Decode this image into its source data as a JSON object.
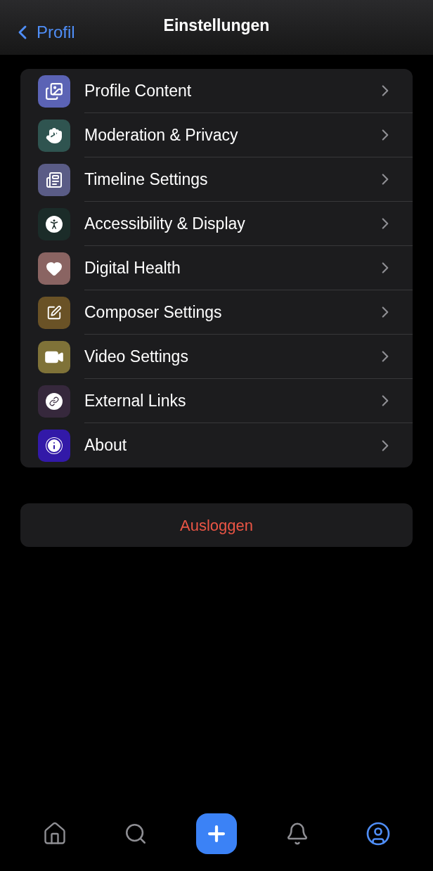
{
  "nav": {
    "back": "Profil",
    "title": "Einstellungen"
  },
  "settings": [
    {
      "label": "Profile Content",
      "color": "#5b63b5"
    },
    {
      "label": "Moderation & Privacy",
      "color": "#2f5450"
    },
    {
      "label": "Timeline Settings",
      "color": "#5a5c86"
    },
    {
      "label": "Accessibility & Display",
      "color": "#1b2c29"
    },
    {
      "label": "Digital Health",
      "color": "#8a6462"
    },
    {
      "label": "Composer Settings",
      "color": "#6a5226"
    },
    {
      "label": "Video Settings",
      "color": "#7f7238"
    },
    {
      "label": "External Links",
      "color": "#36283c"
    },
    {
      "label": "About",
      "color": "#3219a8"
    }
  ],
  "logout": "Ausloggen",
  "tabs": [
    {
      "kind": "home",
      "selected": false
    },
    {
      "kind": "search",
      "selected": false
    },
    {
      "kind": "compose",
      "selected": false
    },
    {
      "kind": "notifications",
      "selected": false
    },
    {
      "kind": "profile",
      "selected": true
    }
  ]
}
